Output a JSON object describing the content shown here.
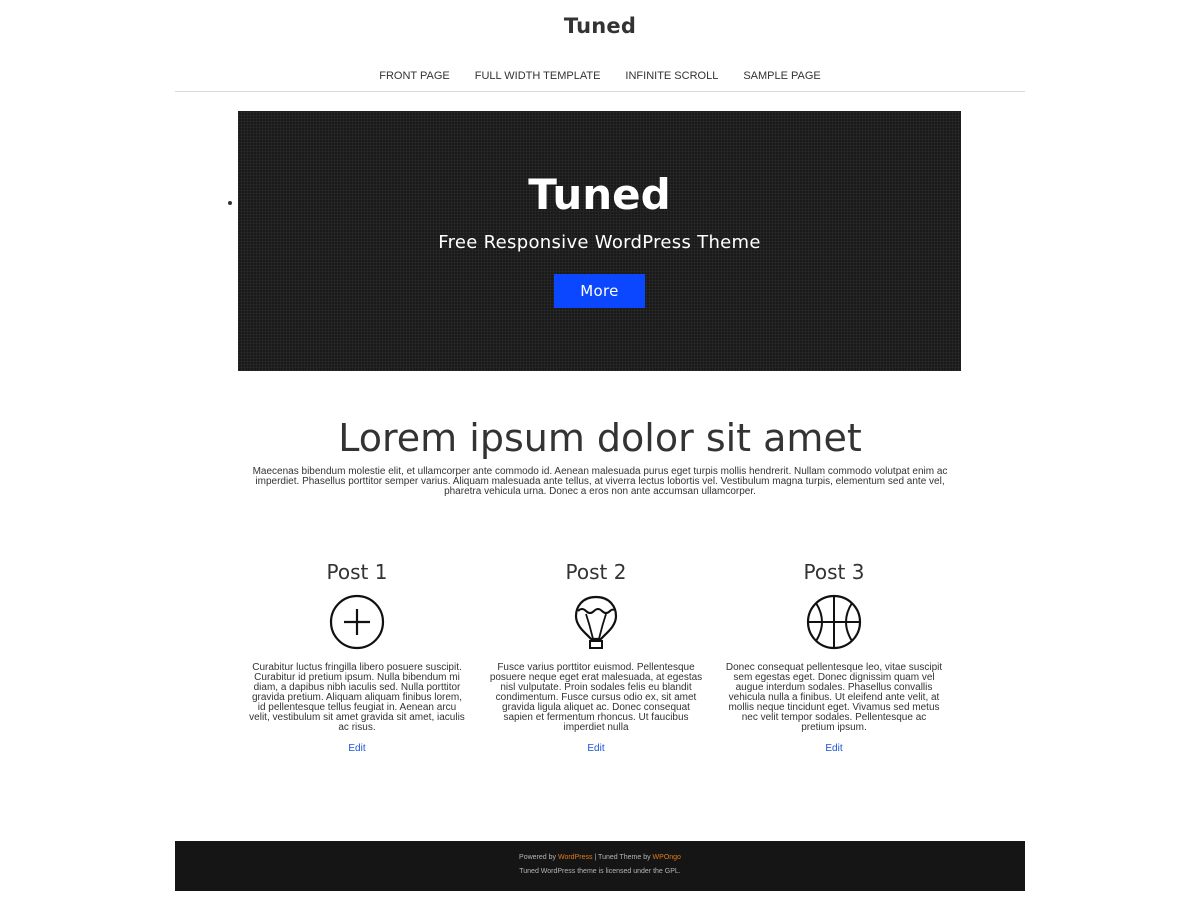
{
  "site": {
    "title": "Tuned"
  },
  "nav": {
    "items": [
      {
        "label": "FRONT PAGE"
      },
      {
        "label": "FULL WIDTH TEMPLATE"
      },
      {
        "label": "INFINITE SCROLL"
      },
      {
        "label": "SAMPLE PAGE"
      }
    ]
  },
  "hero": {
    "title": "Tuned",
    "subtitle": "Free Responsive WordPress Theme",
    "button_label": "More"
  },
  "intro": {
    "heading": "Lorem ipsum dolor sit amet",
    "text": "Maecenas bibendum molestie elit, et ullamcorper ante commodo id. Aenean malesuada purus eget turpis mollis hendrerit. Nullam commodo volutpat enim ac imperdiet. Phasellus porttitor semper varius. Aliquam malesuada ante tellus, at viverra lectus lobortis vel. Vestibulum magna turpis, elementum sed ante vel, pharetra vehicula urna. Donec a eros non ante accumsan ullamcorper."
  },
  "posts": [
    {
      "title": "Post 1",
      "icon": "plus-circle-icon",
      "text": "Curabitur luctus fringilla libero posuere suscipit. Curabitur id pretium ipsum. Nulla bibendum mi diam, a dapibus nibh iaculis sed. Nulla porttitor gravida pretium. Aliquam aliquam finibus lorem, id pellentesque tellus feugiat in. Aenean arcu velit, vestibulum sit amet gravida sit amet, iaculis ac risus.",
      "edit_label": "Edit"
    },
    {
      "title": "Post 2",
      "icon": "hot-air-balloon-icon",
      "text": "Fusce varius porttitor euismod. Pellentesque posuere neque eget erat malesuada, at egestas nisl vulputate. Proin sodales felis eu blandit condimentum. Fusce cursus odio ex, sit amet gravida ligula aliquet ac. Donec consequat sapien et fermentum rhoncus. Ut faucibus imperdiet nulla",
      "edit_label": "Edit"
    },
    {
      "title": "Post 3",
      "icon": "basketball-icon",
      "text": "Donec consequat pellentesque leo, vitae suscipit sem egestas eget. Donec dignissim quam vel augue interdum sodales. Phasellus convallis vehicula nulla a finibus. Ut eleifend ante velit, at mollis neque tincidunt eget. Vivamus sed metus nec velit tempor sodales. Pellentesque ac pretium ipsum.",
      "edit_label": "Edit"
    }
  ],
  "footer": {
    "powered_prefix": "Powered by",
    "wordpress_link": "WordPress",
    "theme_text": "| Tuned Theme by",
    "wpongo_link": "WPOngo",
    "license_text": "Tuned WordPress theme is licensed under the GPL."
  },
  "colors": {
    "accent_button": "#0a47ff",
    "footer_bg": "#151515",
    "footer_link": "#e07b1a",
    "edit_link": "#1a53d6"
  }
}
